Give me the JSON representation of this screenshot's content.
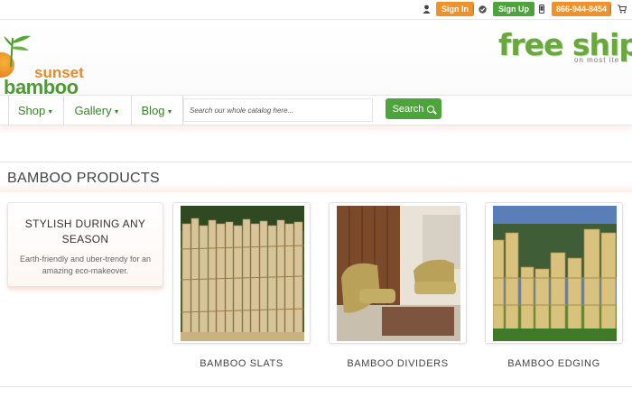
{
  "topbar": {
    "signin_label": "Sign In",
    "signup_label": "Sign Up",
    "phone": "866-944-8454"
  },
  "brand": {
    "word1": "sunset",
    "word2": "bamboo"
  },
  "promo_banner": {
    "big": "free shippi",
    "small": "on most ite"
  },
  "nav": {
    "items": [
      "Shop",
      "Gallery",
      "Blog"
    ],
    "search_placeholder": "Search our whole catalog here...",
    "search_label": "Search"
  },
  "section": {
    "title": "BAMBOO PRODUCTS"
  },
  "promo_card": {
    "title": "STYLISH DURING ANY SEASON",
    "description": "Earth-friendly and uber-trendy for an amazing eco-makeover."
  },
  "products": [
    {
      "label": "BAMBOO SLATS"
    },
    {
      "label": "BAMBOO DIVIDERS"
    },
    {
      "label": "BAMBOO EDGING"
    }
  ],
  "colors": {
    "green": "#4ea43c",
    "orange": "#f0922a",
    "nav_text": "#3b7f2a"
  }
}
